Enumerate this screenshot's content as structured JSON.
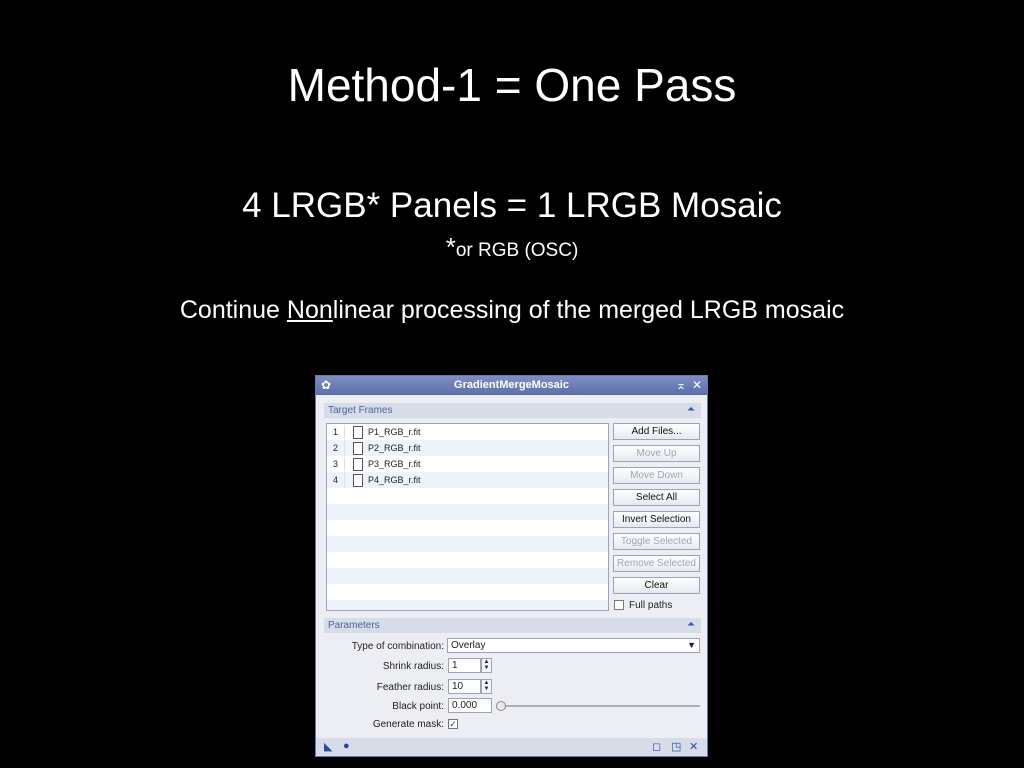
{
  "slide": {
    "title": "Method-1 = One Pass",
    "subtitle": "4 LRGB* Panels = 1 LRGB Mosaic",
    "note_star": "*",
    "note_text": "or RGB (OSC)",
    "continue_pre": "Continue ",
    "continue_underlined": "Non",
    "continue_post": "linear processing of the merged LRGB mosaic"
  },
  "dialog": {
    "title": "GradientMergeMosaic",
    "target_frames_label": "Target Frames",
    "files": [
      {
        "index": "1",
        "name": "P1_RGB_r.fit"
      },
      {
        "index": "2",
        "name": "P2_RGB_r.fit"
      },
      {
        "index": "3",
        "name": "P3_RGB_r.fit"
      },
      {
        "index": "4",
        "name": "P4_RGB_r.fit"
      }
    ],
    "buttons": {
      "add_files": "Add Files...",
      "move_up": "Move Up",
      "move_down": "Move Down",
      "select_all": "Select All",
      "invert_selection": "Invert Selection",
      "toggle_selected": "Toggle Selected",
      "remove_selected": "Remove Selected",
      "clear": "Clear"
    },
    "full_paths_label": "Full paths",
    "full_paths_checked": false,
    "parameters_label": "Parameters",
    "combination_label": "Type of combination:",
    "combination_value": "Overlay",
    "shrink_label": "Shrink radius:",
    "shrink_value": "1",
    "feather_label": "Feather radius:",
    "feather_value": "10",
    "black_label": "Black point:",
    "black_value": "0.000",
    "mask_label": "Generate mask:",
    "mask_checked": true,
    "check_glyph": "✓"
  },
  "colors": {
    "accent": "#5c6ea8",
    "section_text": "#4a63a0"
  }
}
